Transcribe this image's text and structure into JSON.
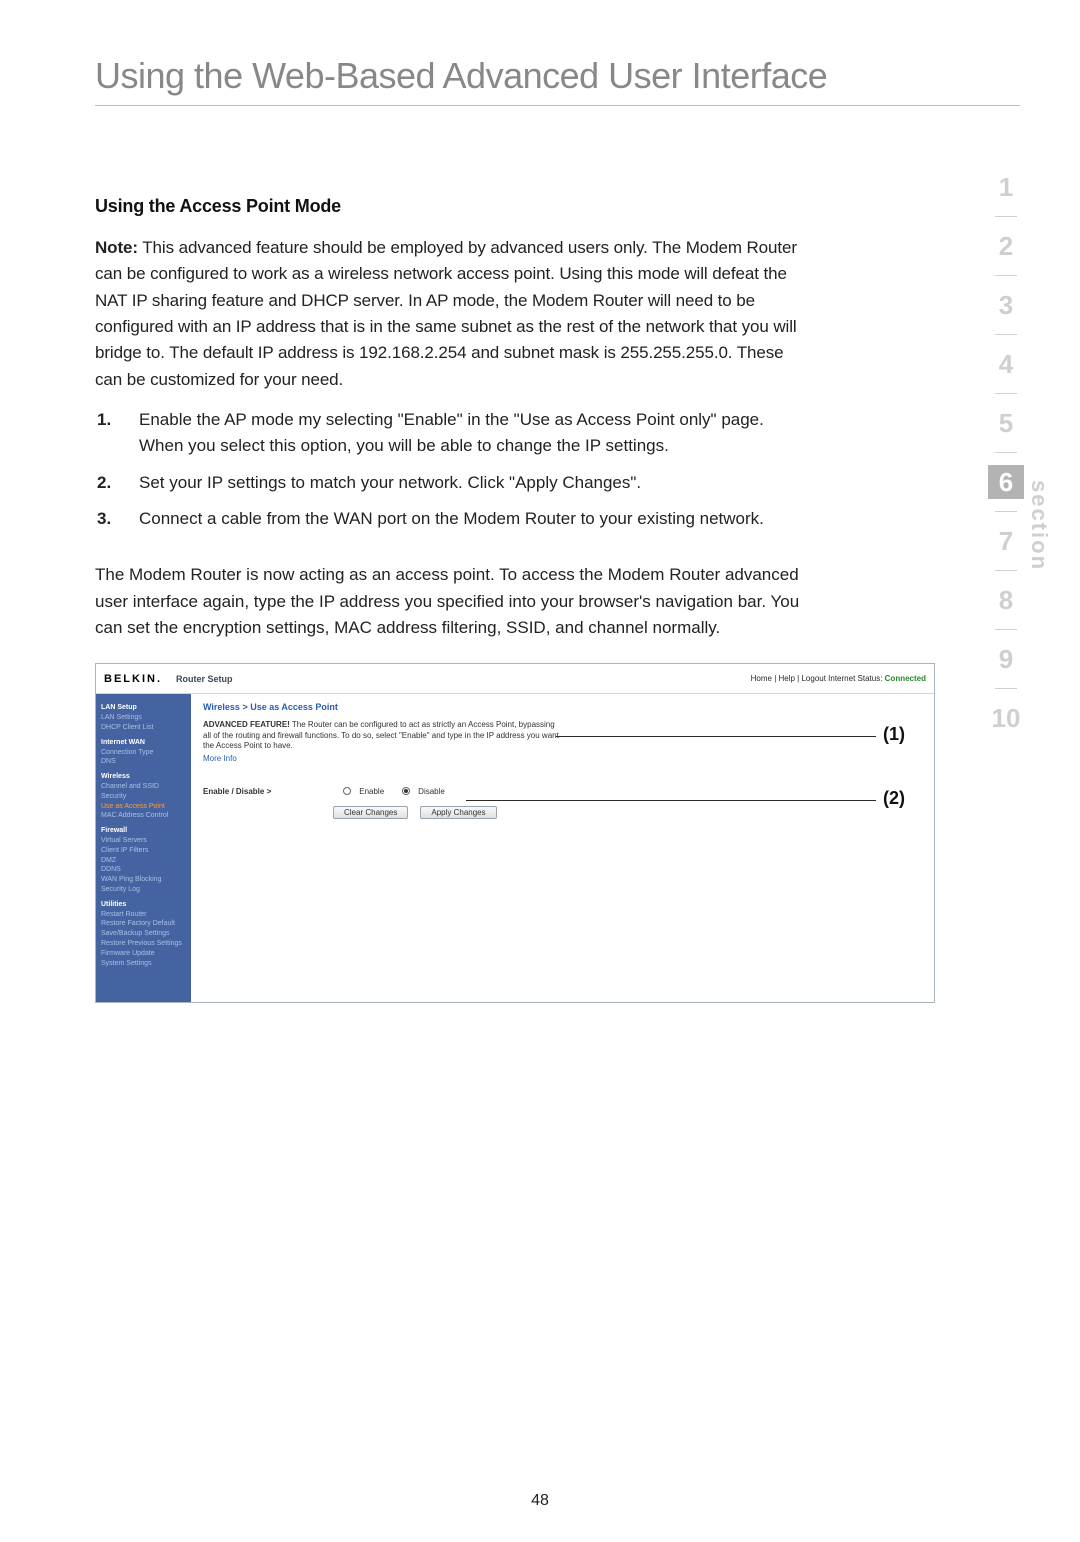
{
  "page_title": "Using the Web-Based Advanced User Interface",
  "sub_heading": "Using the Access Point Mode",
  "note_label": "Note:",
  "note_body": " This advanced feature should be employed by advanced users only. The Modem Router can be configured to work as a wireless network access point. Using this mode will defeat the NAT IP sharing feature and DHCP server. In AP mode, the Modem Router will need to be configured with an IP address that is in the same subnet as the rest of the network that you will bridge to. The default IP address is 192.168.2.254 and subnet mask is 255.255.255.0. These can be customized for your need.",
  "steps": [
    "Enable the AP mode my selecting \"Enable\" in the \"Use as Access Point only\" page. When you select this option, you will be able to change the IP settings.",
    "Set your IP settings to match your network. Click \"Apply Changes\".",
    "Connect a cable from the WAN port on the Modem Router to your existing network."
  ],
  "conclusion": "The Modem Router is now acting as an access point. To access the Modem Router advanced user interface again, type the IP address you specified into your browser's navigation bar. You can set the encryption settings, MAC address filtering, SSID, and channel normally.",
  "section_nav": {
    "items": [
      "1",
      "2",
      "3",
      "4",
      "5",
      "6",
      "7",
      "8",
      "9",
      "10"
    ],
    "active": "6",
    "label": "section"
  },
  "shot": {
    "brand": "BELKIN.",
    "router_setup": "Router Setup",
    "status_left": "Home | Help | Logout   Internet Status:",
    "status_conn": "Connected",
    "sidebar": [
      {
        "t": "grp",
        "v": "LAN Setup"
      },
      {
        "t": "itm",
        "v": "LAN Settings"
      },
      {
        "t": "itm",
        "v": "DHCP Client List"
      },
      {
        "t": "grp",
        "v": "Internet WAN"
      },
      {
        "t": "itm",
        "v": "Connection Type"
      },
      {
        "t": "itm",
        "v": "DNS"
      },
      {
        "t": "grp",
        "v": "Wireless"
      },
      {
        "t": "itm",
        "v": "Channel and SSID"
      },
      {
        "t": "itm",
        "v": "Security"
      },
      {
        "t": "hl",
        "v": "Use as Access Point"
      },
      {
        "t": "itm",
        "v": "MAC Address Control"
      },
      {
        "t": "grp",
        "v": "Firewall"
      },
      {
        "t": "itm",
        "v": "Virtual Servers"
      },
      {
        "t": "itm",
        "v": "Client IP Filters"
      },
      {
        "t": "itm",
        "v": "DMZ"
      },
      {
        "t": "itm",
        "v": "DDNS"
      },
      {
        "t": "itm",
        "v": "WAN Ping Blocking"
      },
      {
        "t": "itm",
        "v": "Security Log"
      },
      {
        "t": "grp",
        "v": "Utilities"
      },
      {
        "t": "itm",
        "v": "Restart Router"
      },
      {
        "t": "itm",
        "v": "Restore Factory Default"
      },
      {
        "t": "itm",
        "v": "Save/Backup Settings"
      },
      {
        "t": "itm",
        "v": "Restore Previous Settings"
      },
      {
        "t": "itm",
        "v": "Firmware Update"
      },
      {
        "t": "itm",
        "v": "System Settings"
      }
    ],
    "breadcrumb": "Wireless > Use as Access Point",
    "adv_label": "ADVANCED FEATURE!",
    "adv_body": " The Router can be configured to act as strictly an Access Point, bypassing all of the routing and firewall functions. To do so, select \"Enable\" and type in the IP address you want the Access Point to have.",
    "more_info": "More Info",
    "ed_label": "Enable / Disable >",
    "enable": "Enable",
    "disable": "Disable",
    "btn_clear": "Clear Changes",
    "btn_apply": "Apply Changes"
  },
  "callouts": {
    "one": "(1)",
    "two": "(2)"
  },
  "page_number": "48"
}
